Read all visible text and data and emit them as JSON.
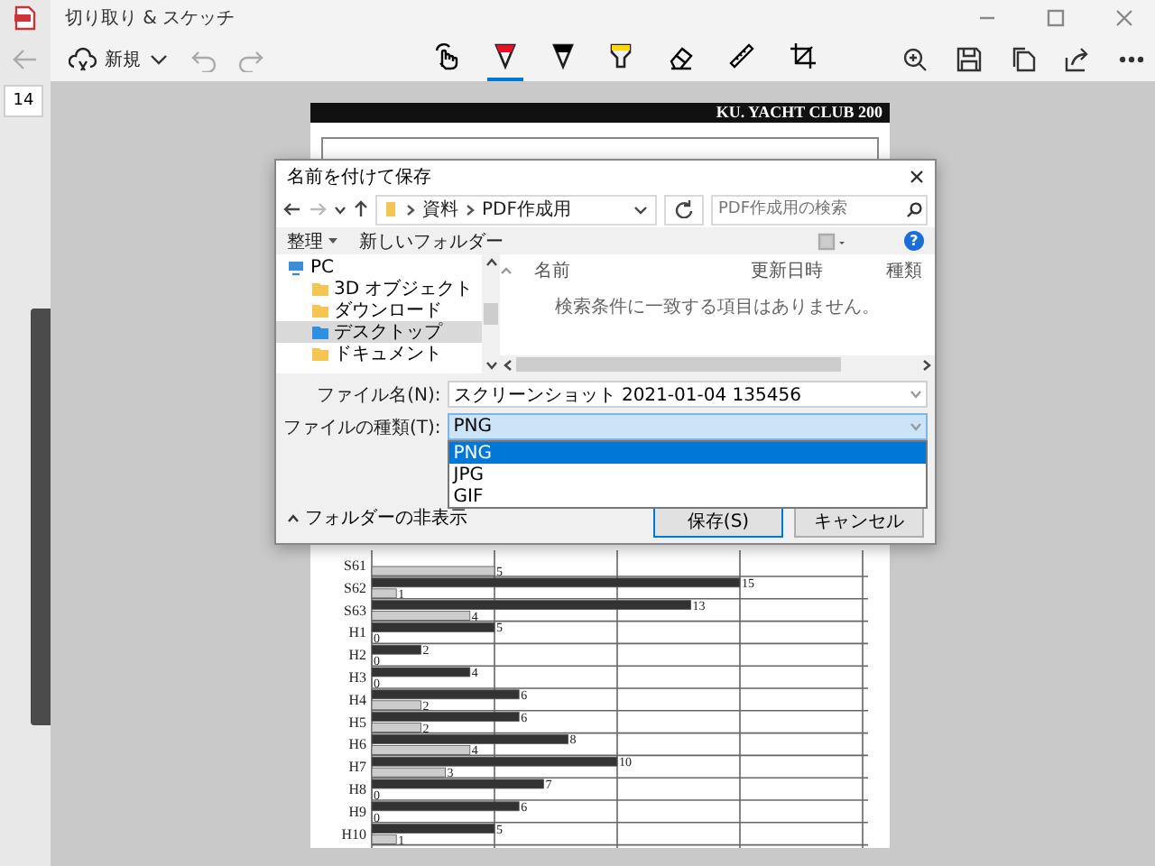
{
  "app": {
    "title": "切り取り & スケッチ",
    "new_button": "新規",
    "page_number": "14",
    "tools": [
      {
        "kind": "touch",
        "selected": false
      },
      {
        "kind": "pen",
        "color": "#e81123",
        "selected": true
      },
      {
        "kind": "pen",
        "color": "#000000",
        "selected": false
      },
      {
        "kind": "highlighter",
        "color": "#ffd800",
        "selected": false
      },
      {
        "kind": "eraser",
        "selected": false
      },
      {
        "kind": "ruler",
        "selected": false
      },
      {
        "kind": "crop",
        "selected": false
      }
    ]
  },
  "document": {
    "header": "KU. YACHT CLUB 200",
    "chart_data": {
      "type": "bar",
      "orientation": "horizontal",
      "data_labels": true,
      "categories": [
        "S61",
        "S62",
        "S63",
        "H1",
        "H2",
        "H3",
        "H4",
        "H5",
        "H6",
        "H7",
        "H8",
        "H9",
        "H10"
      ],
      "series": [
        {
          "color": "#333333",
          "values": [
            null,
            15,
            13,
            5,
            2,
            4,
            6,
            6,
            8,
            10,
            7,
            6,
            5
          ]
        },
        {
          "color": "#cccccc",
          "values": [
            5,
            1,
            4,
            0,
            0,
            0,
            2,
            2,
            4,
            3,
            0,
            0,
            1
          ]
        }
      ]
    }
  },
  "dialog": {
    "title": "名前を付けて保存",
    "breadcrumb": [
      "資料",
      "PDF作成用"
    ],
    "search": {
      "placeholder": "PDF作成用の検索"
    },
    "organize": "整理",
    "new_folder": "新しいフォルダー",
    "help": "?",
    "nav": [
      {
        "label": "PC",
        "selected": false,
        "children": [
          {
            "label": "3D オブジェクト",
            "selected": false
          },
          {
            "label": "ダウンロード",
            "selected": false
          },
          {
            "label": "デスクトップ",
            "selected": true
          },
          {
            "label": "ドキュメント",
            "selected": false
          }
        ]
      }
    ],
    "columns": [
      "名前",
      "更新日時",
      "種類"
    ],
    "empty_message": "検索条件に一致する項目はありません。",
    "file_name": {
      "label": "ファイル名(N):",
      "value": "スクリーンショット 2021-01-04 135456"
    },
    "file_type": {
      "label": "ファイルの種類(T):",
      "value": "PNG",
      "expanded": true,
      "options": [
        {
          "label": "PNG",
          "selected": true
        },
        {
          "label": "JPG",
          "selected": false
        },
        {
          "label": "GIF",
          "selected": false
        }
      ]
    },
    "hide_folders": "フォルダーの非表示",
    "buttons": [
      {
        "label": "保存(S)",
        "kind": "default"
      },
      {
        "label": "キャンセル",
        "kind": "normal"
      }
    ]
  }
}
